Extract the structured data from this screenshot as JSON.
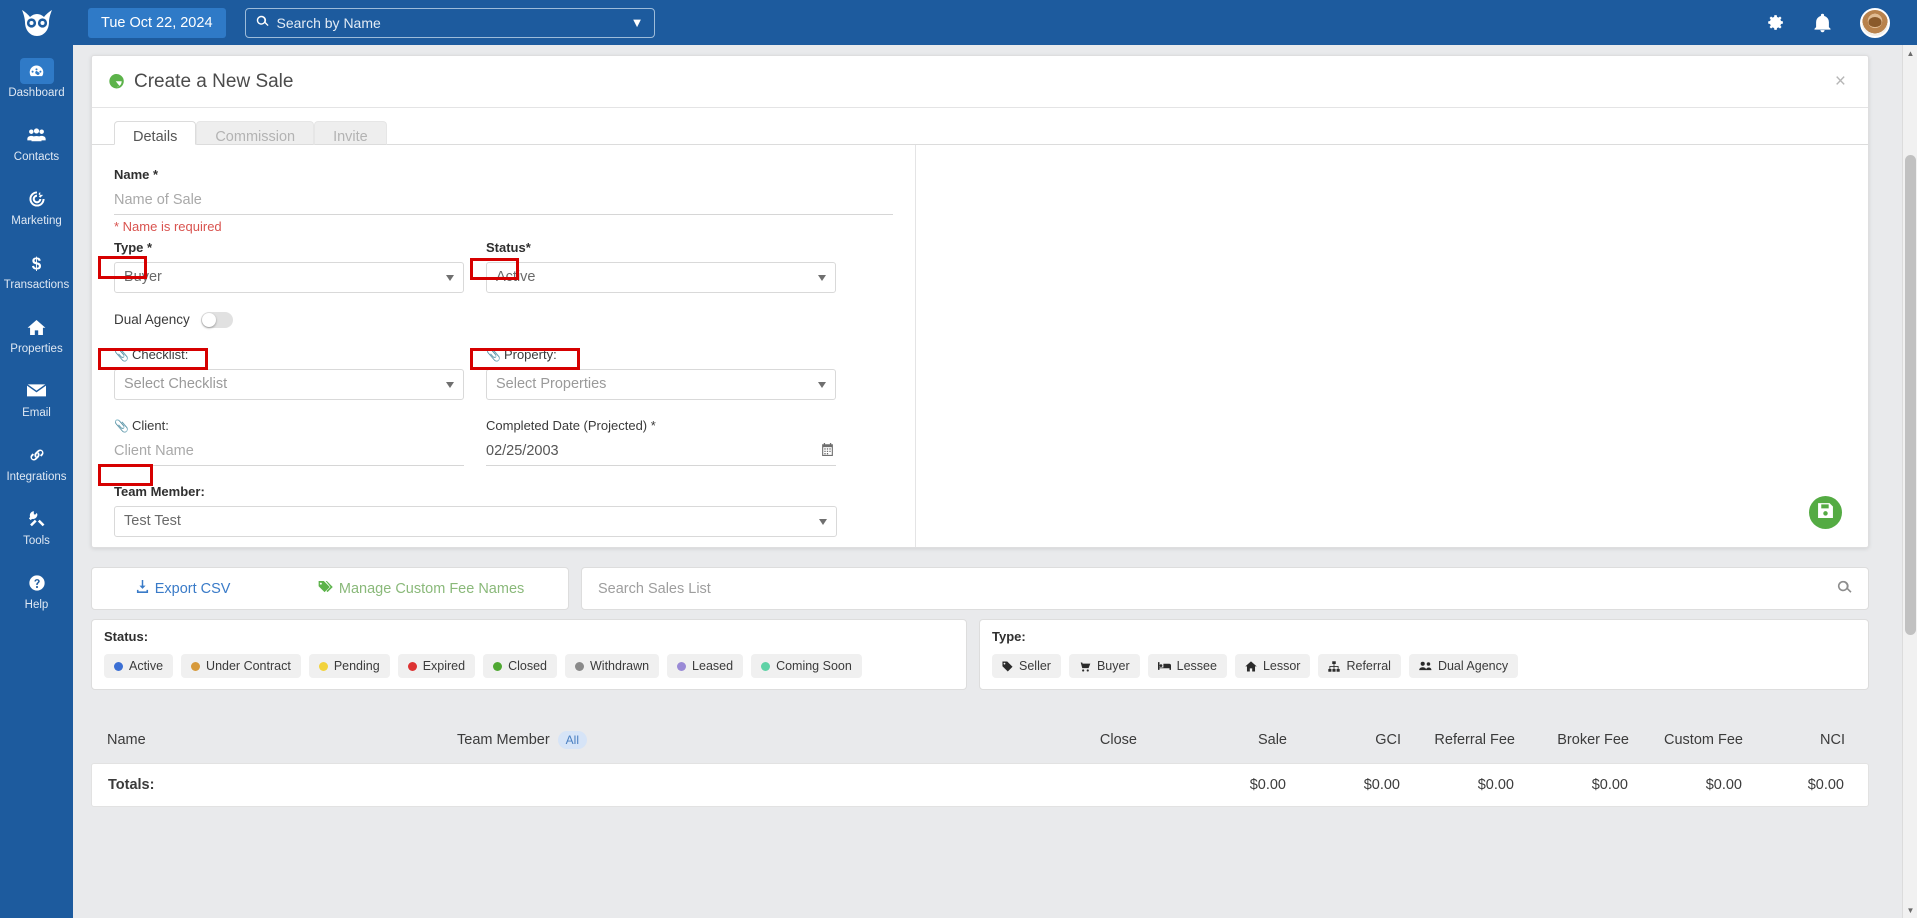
{
  "topbar": {
    "logo_icon": "owl-logo-icon",
    "date": "Tue Oct 22, 2024",
    "search_placeholder": "Search by Name",
    "search_value": "",
    "search_icon": "search-icon",
    "dropdown_icon": "chevron-down-icon",
    "settings_icon": "gear-icon",
    "notifications_icon": "bell-icon",
    "avatar_icon": "user-avatar"
  },
  "sidebar": {
    "items": [
      {
        "label": "Dashboard",
        "icon": "gauge-icon",
        "active": true
      },
      {
        "label": "Contacts",
        "icon": "people-icon",
        "active": false
      },
      {
        "label": "Marketing",
        "icon": "target-icon",
        "active": false
      },
      {
        "label": "Transactions",
        "icon": "dollar-icon",
        "active": false
      },
      {
        "label": "Properties",
        "icon": "home-icon",
        "active": false
      },
      {
        "label": "Email",
        "icon": "envelope-icon",
        "active": false
      },
      {
        "label": "Integrations",
        "icon": "link-icon",
        "active": false
      },
      {
        "label": "Tools",
        "icon": "tools-icon",
        "active": false
      },
      {
        "label": "Help",
        "icon": "question-icon",
        "active": false
      }
    ]
  },
  "modal": {
    "title": "Create a New Sale",
    "title_icon": "pie-chart-icon",
    "close_label": "×",
    "tabs": [
      {
        "label": "Details",
        "active": true
      },
      {
        "label": "Commission",
        "active": false
      },
      {
        "label": "Invite",
        "active": false
      }
    ],
    "form": {
      "name_label": "Name *",
      "name_placeholder": "Name of Sale",
      "name_value": "",
      "name_error": "* Name is required",
      "type_label": "Type *",
      "type_value": "Buyer",
      "status_label": "Status*",
      "status_value": "Active",
      "dual_agency_label": "Dual Agency",
      "dual_agency_on": false,
      "checklist_label": "Checklist:",
      "checklist_value": "Select Checklist",
      "property_label": "Property:",
      "property_value": "Select Properties",
      "client_label": "Client:",
      "client_placeholder": "Client Name",
      "client_value": "",
      "completed_date_label": "Completed Date (Projected) *",
      "completed_date_value": "02/25/2003",
      "calendar_icon": "calendar-icon",
      "team_member_label": "Team Member:",
      "team_member_value": "Test Test"
    },
    "save_icon": "save-disk-icon"
  },
  "toolbar": {
    "export_label": "Export CSV",
    "export_icon": "download-icon",
    "manage_fees_label": "Manage Custom Fee Names",
    "manage_fees_icon": "tag-icon",
    "search_placeholder": "Search Sales List",
    "search_value": "",
    "search_icon": "search-icon"
  },
  "filters": {
    "status_title": "Status:",
    "status_chips": [
      {
        "label": "Active",
        "color": "#3b6fd4"
      },
      {
        "label": "Under Contract",
        "color": "#d79a3c"
      },
      {
        "label": "Pending",
        "color": "#f2d33c"
      },
      {
        "label": "Expired",
        "color": "#dd3333"
      },
      {
        "label": "Closed",
        "color": "#4fa832"
      },
      {
        "label": "Withdrawn",
        "color": "#8a8a8a"
      },
      {
        "label": "Leased",
        "color": "#9a8ad6"
      },
      {
        "label": "Coming Soon",
        "color": "#5fd2a6"
      }
    ],
    "type_title": "Type:",
    "type_chips": [
      {
        "label": "Seller",
        "icon": "tag-icon"
      },
      {
        "label": "Buyer",
        "icon": "cart-icon"
      },
      {
        "label": "Lessee",
        "icon": "bed-icon"
      },
      {
        "label": "Lessor",
        "icon": "home-icon"
      },
      {
        "label": "Referral",
        "icon": "sitemap-icon"
      },
      {
        "label": "Dual Agency",
        "icon": "people-icon"
      }
    ]
  },
  "table": {
    "headers": {
      "name": "Name",
      "team_member": "Team Member",
      "team_member_pill": "All",
      "close": "Close",
      "sale": "Sale",
      "gci": "GCI",
      "referral_fee": "Referral Fee",
      "broker_fee": "Broker Fee",
      "custom_fee": "Custom Fee",
      "nci": "NCI"
    },
    "totals": {
      "label": "Totals:",
      "sale": "$0.00",
      "gci": "$0.00",
      "referral_fee": "$0.00",
      "broker_fee": "$0.00",
      "custom_fee": "$0.00",
      "nci": "$0.00"
    }
  },
  "colors": {
    "brand_blue": "#1d5b9e",
    "accent_blue": "#2f7ac7",
    "green": "#54ab43",
    "annotation_red": "#d60000",
    "error_red": "#d9534f"
  }
}
